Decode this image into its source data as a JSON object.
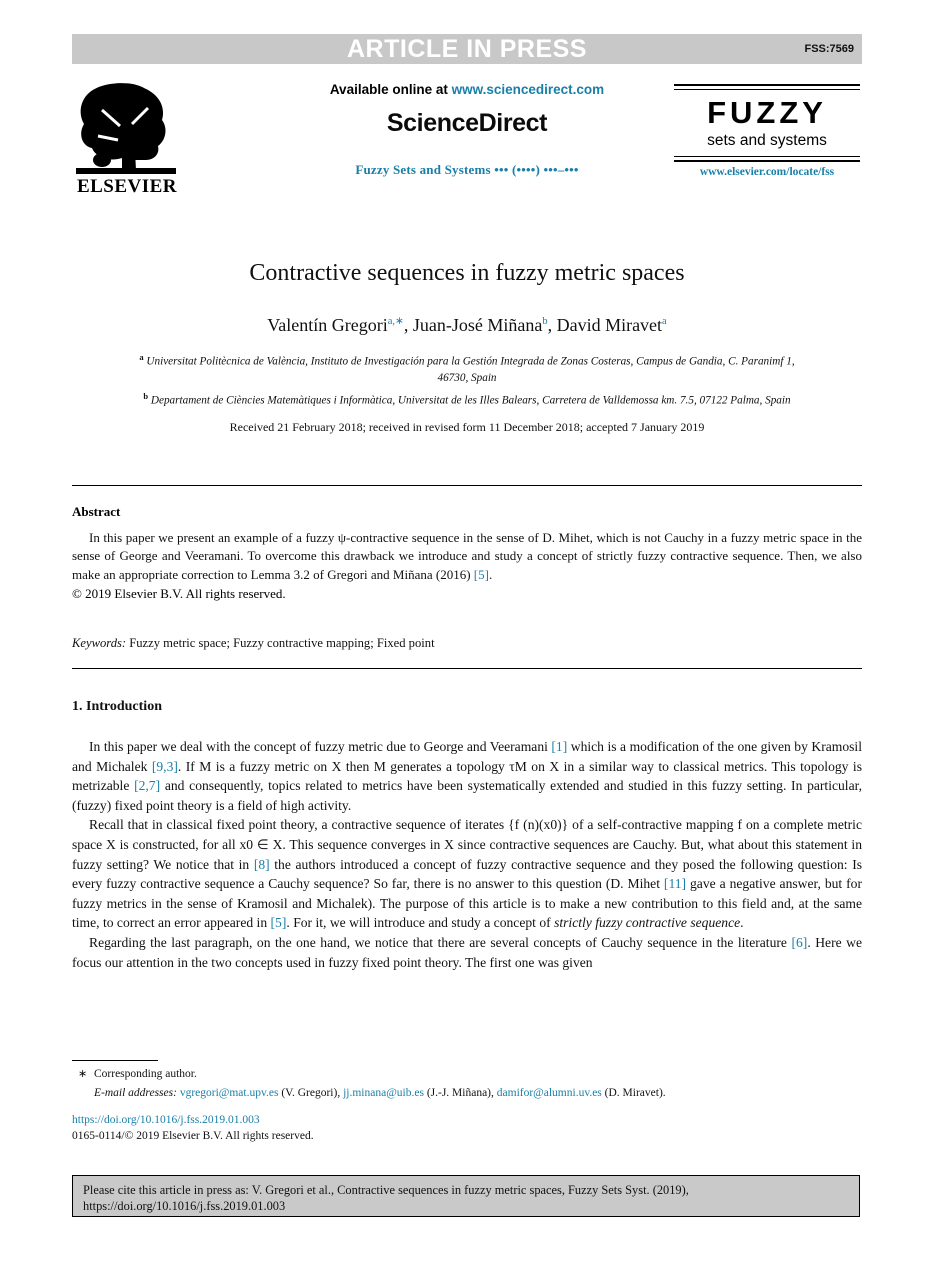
{
  "banner": {
    "label": "ARTICLE IN PRESS",
    "article_code": "FSS:7569",
    "bg_color": "#c8c8c8",
    "text_color": "#ffffff"
  },
  "masthead": {
    "publisher_logo_name": "ELSEVIER",
    "available_prefix": "Available online at ",
    "available_url": "www.sciencedirect.com",
    "sciencedirect_wordmark": "ScienceDirect",
    "journal_reference": "Fuzzy Sets and Systems ••• (••••) •••–•••",
    "journal_logo_title": "FUZZY",
    "journal_logo_subtitle": "sets and systems",
    "journal_url": "www.elsevier.com/locate/fss",
    "link_color": "#1a7fa8"
  },
  "article": {
    "title": "Contractive sequences in fuzzy metric spaces",
    "authors": [
      {
        "name": "Valentín Gregori",
        "sup": "a,",
        "star": "∗"
      },
      {
        "name": "Juan-José Miñana",
        "sup": "b",
        "star": ""
      },
      {
        "name": "David Miravet",
        "sup": "a",
        "star": ""
      }
    ],
    "affiliation_a_marker": "a",
    "affiliation_a_line1": "Universitat Politècnica de València, Instituto de Investigación para la Gestión Integrada de Zonas Costeras, Campus de Gandia, C. Paranimf 1,",
    "affiliation_a_line2": "46730, Spain",
    "affiliation_b_marker": "b",
    "affiliation_b_line1": "Departament de Ciències Matemàtiques i Informàtica, Universitat de les Illes Balears, Carretera de Valldemossa km. 7.5, 07122 Palma, Spain",
    "received_line": "Received 21 February 2018; received in revised form 11 December 2018; accepted 7 January 2019"
  },
  "abstract": {
    "heading": "Abstract",
    "body_part1": "In this paper we present an example of a fuzzy ψ-contractive sequence in the sense of D. Mihet, which is not Cauchy in a fuzzy metric space in the sense of George and Veeramani. To overcome this drawback we introduce and study a concept of strictly fuzzy contractive sequence. Then, we also make an appropriate correction to Lemma 3.2 of Gregori and Miñana (2016) ",
    "body_ref": "[5]",
    "body_part2": ".",
    "copyright": "© 2019 Elsevier B.V. All rights reserved."
  },
  "keywords": {
    "label": "Keywords:",
    "value": " Fuzzy metric space; Fuzzy contractive mapping; Fixed point"
  },
  "introduction": {
    "heading": "1. Introduction",
    "p1_a": "In this paper we deal with the concept of fuzzy metric due to George and Veeramani ",
    "p1_r1": "[1]",
    "p1_b": " which is a modification of the one given by Kramosil and Michalek ",
    "p1_r2": "[9,3]",
    "p1_c": ". If M is a fuzzy metric on X then M generates a topology τM on X in a similar way to classical metrics. This topology is metrizable ",
    "p1_r3": "[2,7]",
    "p1_d": " and consequently, topics related to metrics have been systematically extended and studied in this fuzzy setting. In particular, (fuzzy) fixed point theory is a field of high activity.",
    "p2_a": "Recall that in classical fixed point theory, a contractive sequence of iterates {f (n)(x0)} of a self-contractive mapping f on a complete metric space X is constructed, for all x0 ∈ X. This sequence converges in X since contractive sequences are Cauchy. But, what about this statement in fuzzy setting? We notice that in ",
    "p2_r1": "[8]",
    "p2_b": " the authors introduced a concept of fuzzy contractive sequence and they posed the following question: Is every fuzzy contractive sequence a Cauchy sequence? So far, there is no answer to this question (D. Mihet ",
    "p2_r2": "[11]",
    "p2_c": " gave a negative answer, but for fuzzy metrics in the sense of Kramosil and Michalek). The purpose of this article is to make a new contribution to this field and, at the same time, to correct an error appeared in ",
    "p2_r3": "[5]",
    "p2_d": ". For it, we will introduce and study a concept of ",
    "p2_italic": "strictly fuzzy contractive sequence",
    "p2_e": ".",
    "p3_a": "Regarding the last paragraph, on the one hand, we notice that there are several concepts of Cauchy sequence in the literature ",
    "p3_r1": "[6]",
    "p3_b": ". Here we focus our attention in the two concepts used in fuzzy fixed point theory. The first one was given"
  },
  "footnote": {
    "star": "∗",
    "corresponding": "Corresponding author.",
    "email_label": "E-mail addresses:",
    "emails": [
      {
        "address": "vgregori@mat.upv.es",
        "person": " (V. Gregori), "
      },
      {
        "address": "jj.minana@uib.es",
        "person": " (J.-J. Miñana), "
      },
      {
        "address": "damifor@alumni.uv.es",
        "person": " (D. Miravet)."
      }
    ],
    "doi": "https://doi.org/10.1016/j.fss.2019.01.003",
    "issn": "0165-0114/© 2019 Elsevier B.V. All rights reserved."
  },
  "cite_box": {
    "line1": "Please cite this article in press as: V. Gregori et al., Contractive sequences in fuzzy metric spaces, Fuzzy Sets Syst. (2019),",
    "line2": "https://doi.org/10.1016/j.fss.2019.01.003",
    "bg_color": "#c9c9c9"
  }
}
